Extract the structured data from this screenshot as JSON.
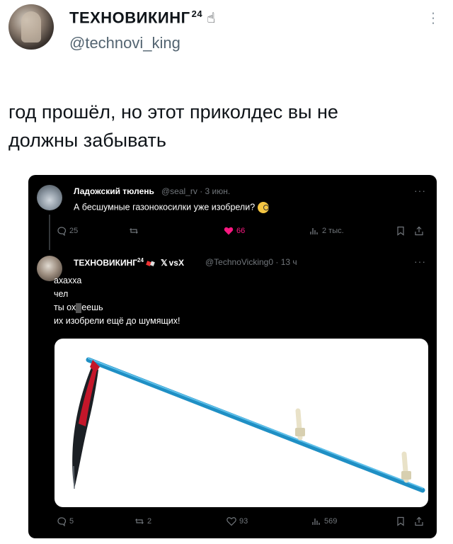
{
  "author": {
    "name": "ТЕХНОВИКИНГ",
    "name_sup": "24",
    "hand_emoji": "☝",
    "handle": "@technovi_king",
    "avatar_icon": "avatar-photo"
  },
  "tweet": {
    "text_line1": "год прошёл, но этот приколдес вы не",
    "text_line2": "должны забывать"
  },
  "embedded": {
    "reply1": {
      "name": "Ладожский тюлень",
      "handle": "@seal_rv",
      "time": "· 3 июн.",
      "text": "А бесшумные газонокосилки уже изобрели?",
      "actions": {
        "replies": "25",
        "retweets": "",
        "likes": "66",
        "views": "2 тыс."
      }
    },
    "reply2": {
      "name": "ТЕХНОВИКИНГ",
      "name_sup": "24",
      "vs_label": "vsX",
      "handle": "@TechnoVicking0",
      "time": "· 13 ч",
      "line1": "ахахха",
      "line2": "чел",
      "line3_a": "ты ох",
      "line3_b": "еешь",
      "line4": "их изобрели ещё до шумящих!",
      "actions": {
        "replies": "5",
        "retweets": "2",
        "likes": "93",
        "views": "569"
      }
    },
    "more_label": "···",
    "media_subject": "scythe",
    "colors": {
      "card_bg": "#000000",
      "like_pink": "#f91880",
      "scythe_blade": "#c4162a",
      "scythe_handle": "#1f8fc4"
    }
  }
}
